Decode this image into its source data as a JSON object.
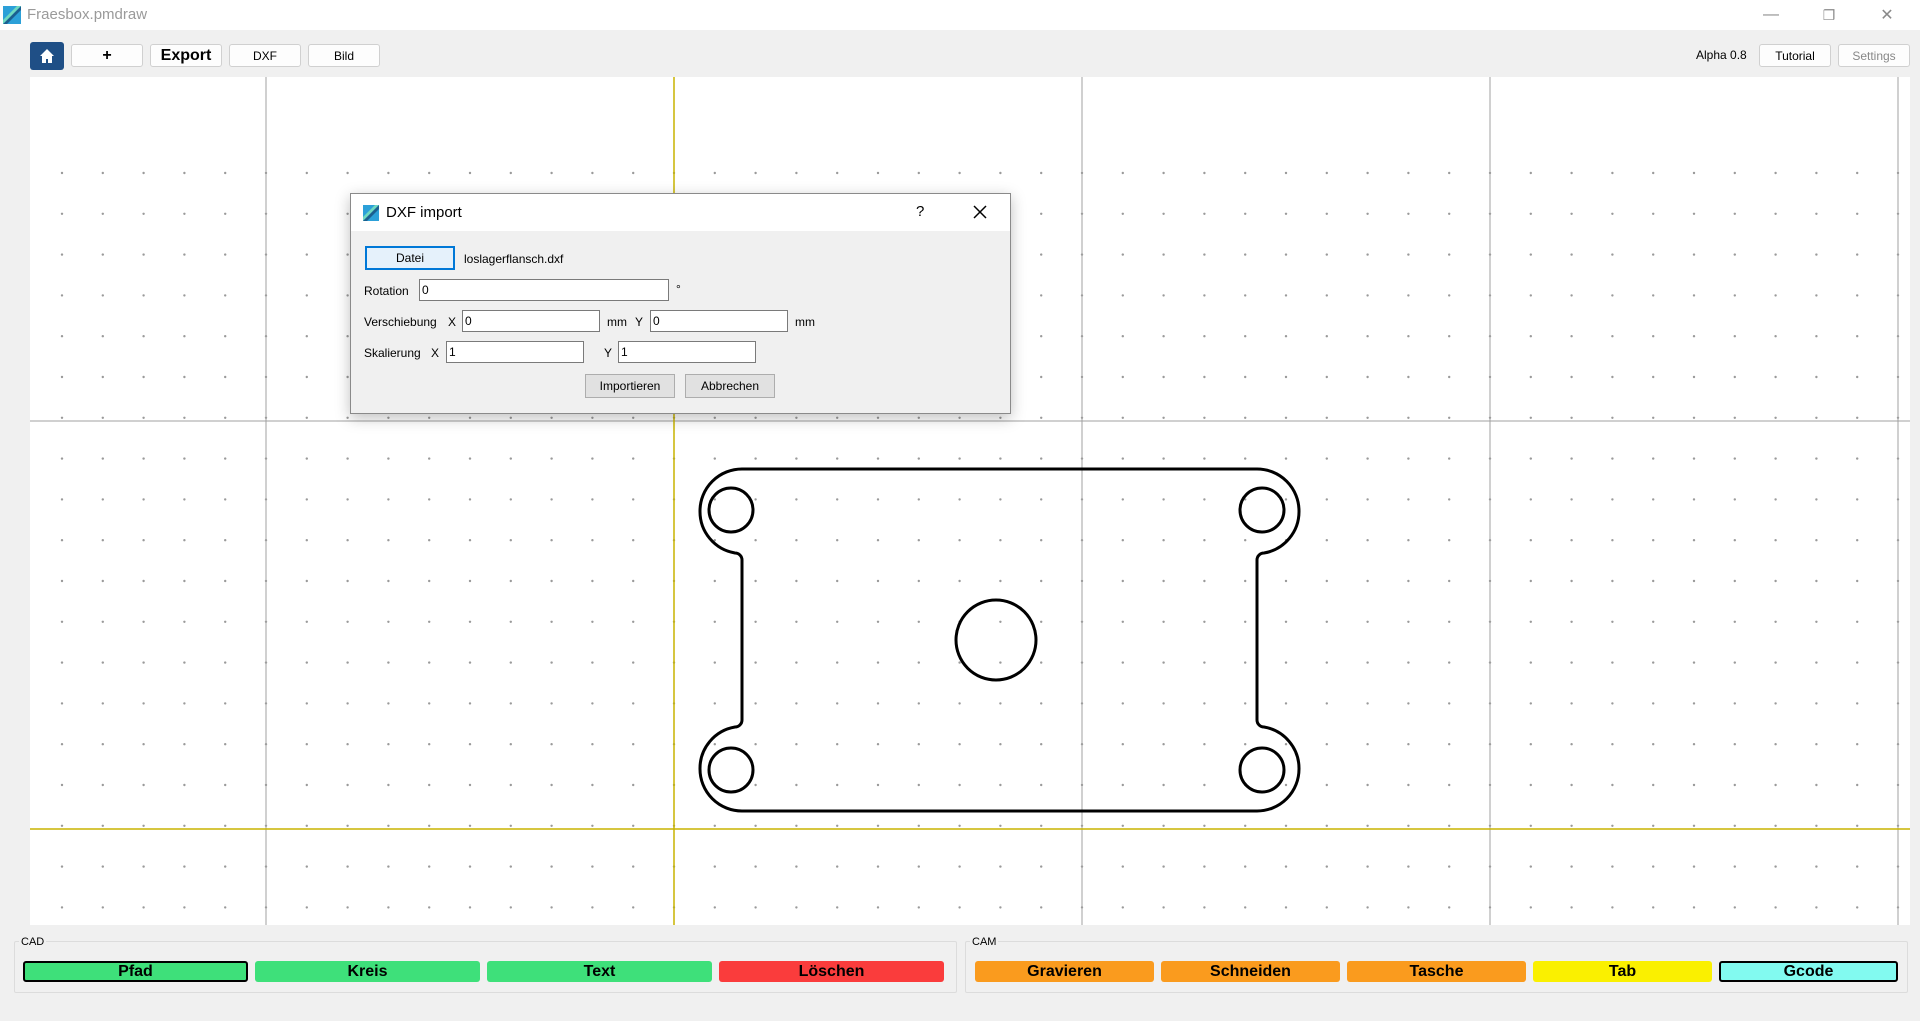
{
  "window": {
    "title": "Fraesbox.pmdraw",
    "minimize": "—",
    "restore": "❐",
    "close": "✕"
  },
  "toolbar": {
    "add_label": "+",
    "export_label": "Export",
    "dxf_label": "DXF",
    "bild_label": "Bild",
    "version": "Alpha 0.8",
    "tutorial_label": "Tutorial",
    "settings_label": "Settings"
  },
  "dialog": {
    "title": "DXF import",
    "help": "?",
    "file_button": "Datei",
    "filename": "loslagerflansch.dxf",
    "rotation_label": "Rotation",
    "rotation_value": "0",
    "rotation_unit": "°",
    "shift_label": "Verschiebung",
    "shift_x_label": "X",
    "shift_x_value": "0",
    "shift_x_unit": "mm",
    "shift_y_label": "Y",
    "shift_y_value": "0",
    "shift_y_unit": "mm",
    "scale_label": "Skalierung",
    "scale_x_label": "X",
    "scale_x_value": "1",
    "scale_y_label": "Y",
    "scale_y_value": "1",
    "import_button": "Importieren",
    "cancel_button": "Abbrechen"
  },
  "cad_panel": {
    "label": "CAD",
    "buttons": [
      {
        "label": "Pfad",
        "color": "#3ee07a"
      },
      {
        "label": "Kreis",
        "color": "#3ee07a"
      },
      {
        "label": "Text",
        "color": "#3ee07a"
      },
      {
        "label": "Löschen",
        "color": "#fa3c3c"
      }
    ]
  },
  "cam_panel": {
    "label": "CAM",
    "buttons": [
      {
        "label": "Gravieren",
        "color": "#fa9b1e"
      },
      {
        "label": "Schneiden",
        "color": "#fa9b1e"
      },
      {
        "label": "Tasche",
        "color": "#fa9b1e"
      },
      {
        "label": "Tab",
        "color": "#faf000"
      },
      {
        "label": "Gcode",
        "color": "#82faf0"
      }
    ]
  },
  "colors": {
    "accent_home": "#1f4f86",
    "axis": "#c8b400",
    "grid": "#a0a0a0"
  }
}
